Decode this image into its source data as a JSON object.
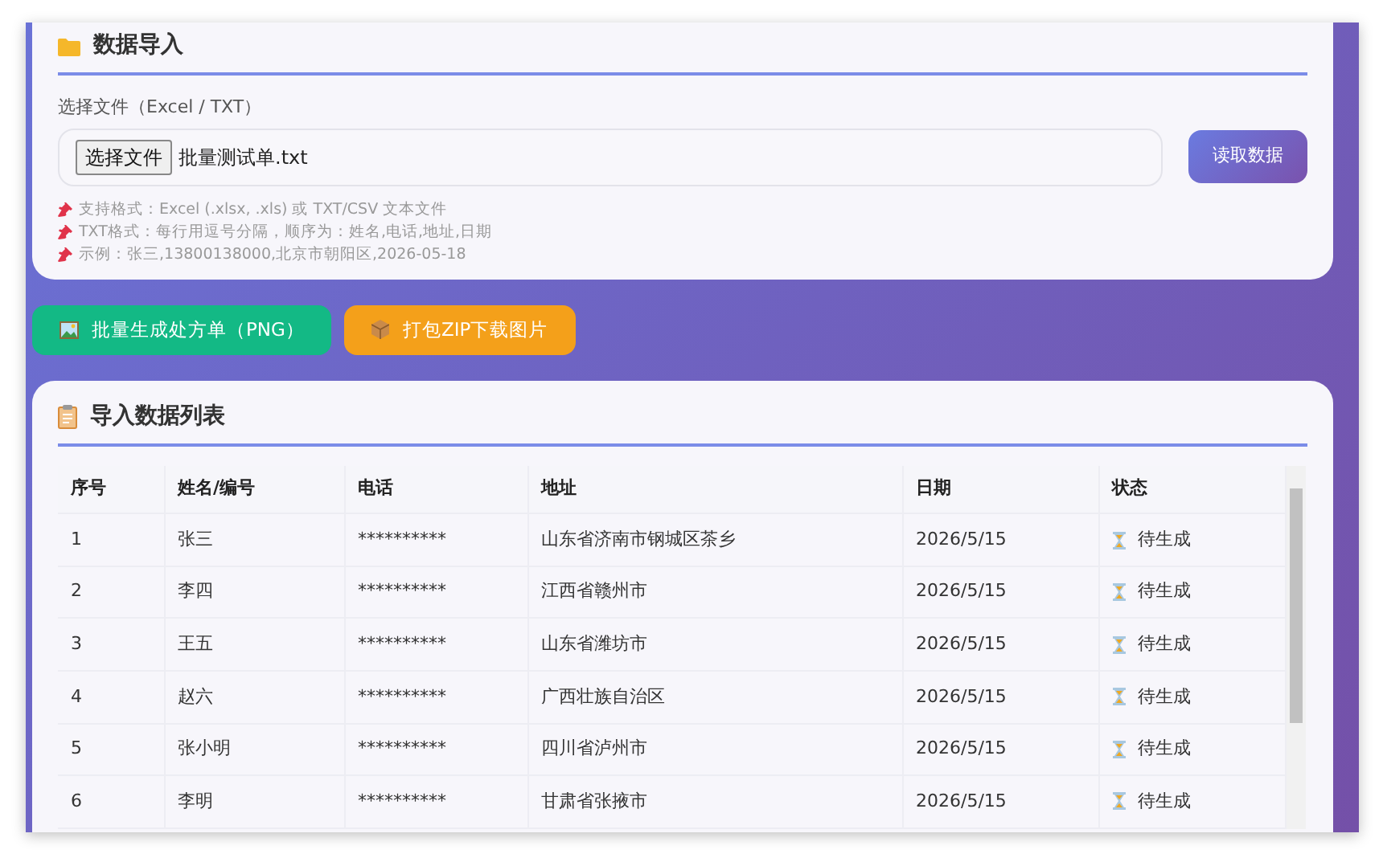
{
  "import_panel": {
    "title": "数据导入",
    "file_label": "选择文件（Excel / TXT）",
    "choose_button": "选择文件",
    "file_name": "批量测试单.txt",
    "read_button": "读取数据",
    "hints": [
      "支持格式：Excel (.xlsx, .xls) 或 TXT/CSV 文本文件",
      "TXT格式：每行用逗号分隔，顺序为：姓名,电话,地址,日期",
      "示例：张三,13800138000,北京市朝阳区,2026-05-18"
    ]
  },
  "actions": [
    {
      "kind": "generate",
      "label": "批量生成处方单（PNG）"
    },
    {
      "kind": "zip",
      "label": "打包ZIP下载图片"
    }
  ],
  "table_panel": {
    "title": "导入数据列表",
    "columns": [
      "序号",
      "姓名/编号",
      "电话",
      "地址",
      "日期",
      "状态"
    ],
    "rows": [
      {
        "index": "1",
        "name": "张三",
        "phone": "**********",
        "address": "山东省济南市钢城区茶乡",
        "date": "2026/5/15",
        "status": "待生成"
      },
      {
        "index": "2",
        "name": "李四",
        "phone": "**********",
        "address": "江西省赣州市",
        "date": "2026/5/15",
        "status": "待生成"
      },
      {
        "index": "3",
        "name": "王五",
        "phone": "**********",
        "address": "山东省潍坊市",
        "date": "2026/5/15",
        "status": "待生成"
      },
      {
        "index": "4",
        "name": "赵六",
        "phone": "**********",
        "address": "广西壮族自治区",
        "date": "2026/5/15",
        "status": "待生成"
      },
      {
        "index": "5",
        "name": "张小明",
        "phone": "**********",
        "address": "四川省泸州市",
        "date": "2026/5/15",
        "status": "待生成"
      },
      {
        "index": "6",
        "name": "李明",
        "phone": "**********",
        "address": "甘肃省张掖市",
        "date": "2026/5/15",
        "status": "待生成"
      }
    ]
  }
}
